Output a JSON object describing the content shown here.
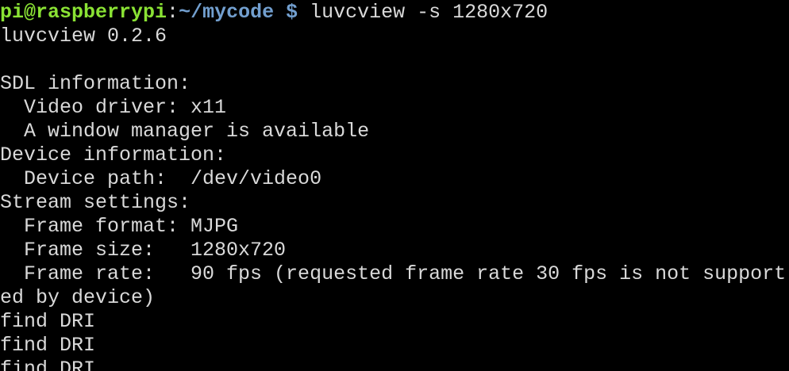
{
  "terminal": {
    "prompt": {
      "user_host": "pi@raspberrypi",
      "separator": ":",
      "path": "~/mycode",
      "sign": "$",
      "command": " luvcview -s 1280x720"
    },
    "output": [
      "luvcview 0.2.6",
      "",
      "SDL information:",
      "  Video driver: x11",
      "  A window manager is available",
      "Device information:",
      "  Device path:  /dev/video0",
      "Stream settings:",
      "  Frame format: MJPG",
      "  Frame size:   1280x720",
      "  Frame rate:   90 fps (requested frame rate 30 fps is not support",
      "ed by device)",
      "find DRI",
      "find DRI",
      "find DRI"
    ]
  },
  "colors": {
    "background": "#000000",
    "text": "#d9d9d9",
    "prompt_user": "#8ae234",
    "prompt_path": "#729fcf"
  }
}
